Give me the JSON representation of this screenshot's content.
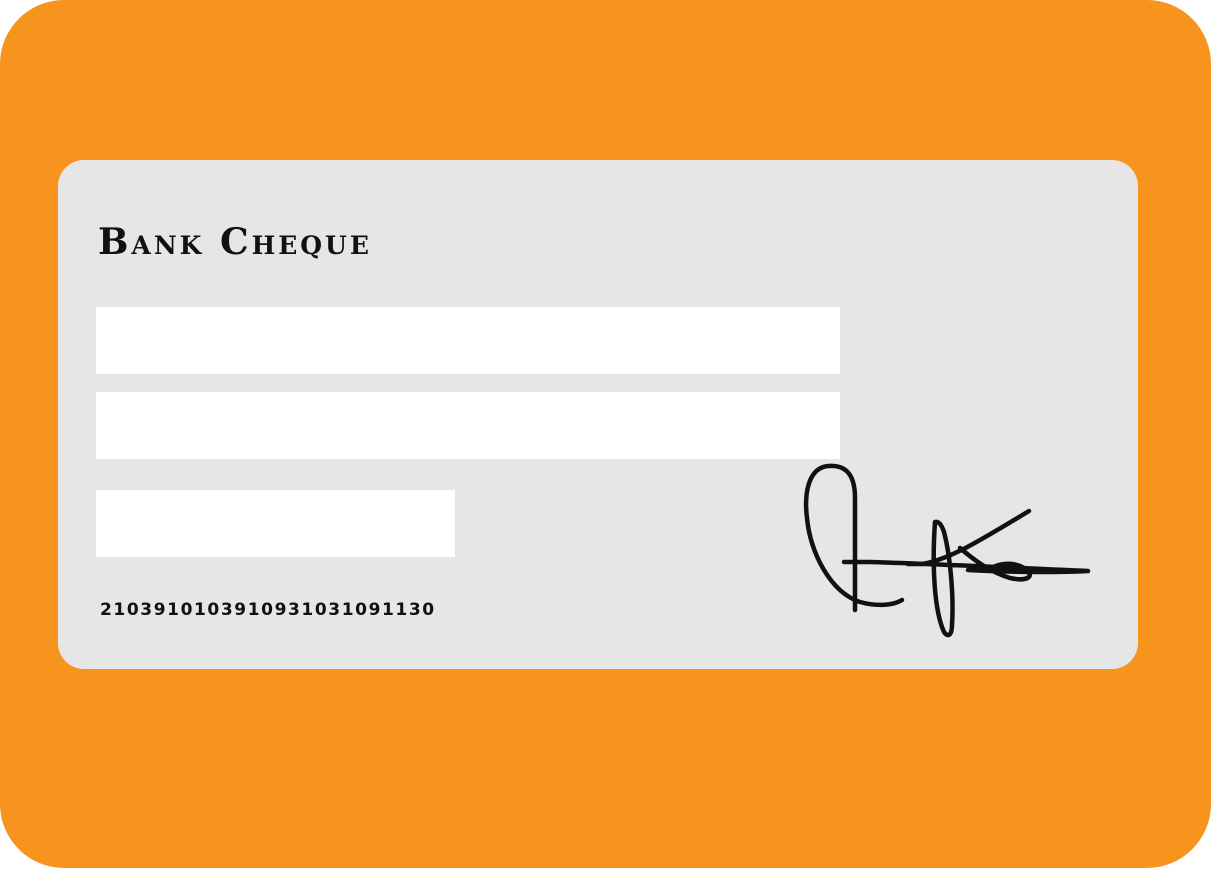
{
  "colors": {
    "background": "#f7941e",
    "cheque": "#e6e6e6",
    "field": "#ffffff",
    "ink": "#111111"
  },
  "cheque": {
    "title": "Bank Cheque",
    "fields": [
      {
        "value": "",
        "placeholder": ""
      },
      {
        "value": "",
        "placeholder": ""
      },
      {
        "value": "",
        "placeholder": ""
      }
    ],
    "account_number": "2103910103910931031091130",
    "signature_icon": "handwritten-signature"
  }
}
